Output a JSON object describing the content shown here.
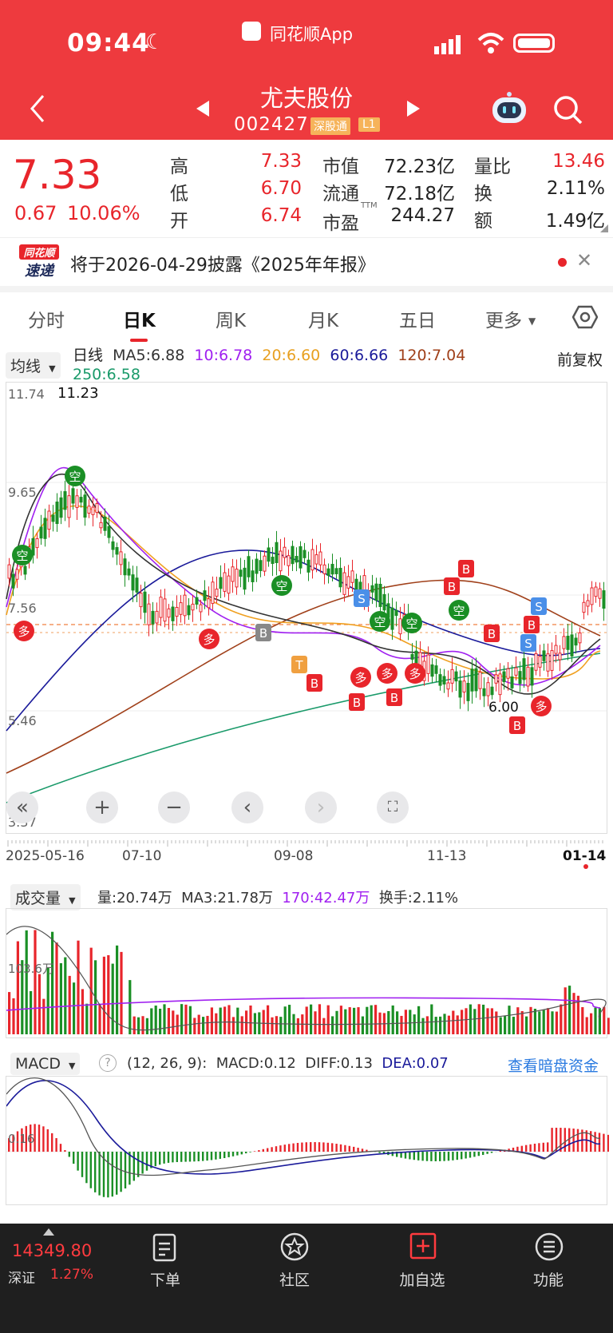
{
  "status_bar": {
    "time": "09:44",
    "app": "同花顺App"
  },
  "header": {
    "title": "尤夫股份",
    "code": "002427",
    "tag_connect": "深股通",
    "tag_level": "L1"
  },
  "quote": {
    "price": "7.33",
    "change": "0.67",
    "change_pct": "10.06%",
    "high_label": "高",
    "high": "7.33",
    "low_label": "低",
    "low": "6.70",
    "open_label": "开",
    "open": "6.74",
    "mcap_label": "市值",
    "mcap": "72.23亿",
    "float_label": "流通",
    "float": "72.18亿",
    "pe_label": "市盈",
    "pe_sup": "TTM",
    "pe": "244.27",
    "vr_label": "量比",
    "vr": "13.46",
    "turn_label": "换",
    "turn": "2.11%",
    "amt_label": "额",
    "amt": "1.49亿"
  },
  "news": {
    "badge_top": "同花顺",
    "badge_bottom": "速递",
    "text": "将于2026-04-29披露《2025年年报》"
  },
  "tabs": [
    "分时",
    "日K",
    "周K",
    "月K",
    "五日",
    "更多"
  ],
  "ma_legend": {
    "selector": "均线",
    "kind": "日线",
    "ma5": "MA5:6.88",
    "ma10": "10:6.78",
    "ma20": "20:6.60",
    "ma60": "60:6.66",
    "ma120": "120:7.04",
    "ma250": "250:6.58",
    "adjust": "前复权"
  },
  "price_axis": {
    "top": "11.74",
    "high_mark": "11.23",
    "p2": "9.65",
    "p3": "7.56",
    "p4": "5.46",
    "bottom": "3.37",
    "low_mark": "6.00"
  },
  "dates": [
    "2025-05-16",
    "07-10",
    "09-08",
    "11-13",
    "01-14"
  ],
  "volume": {
    "selector": "成交量",
    "vol": "量:20.74万",
    "ma3": "MA3:21.78万",
    "ma170": "170:42.47万",
    "turnover": "换手:2.11%",
    "axis": "103.6万"
  },
  "macd": {
    "selector": "MACD",
    "help": "?",
    "params": "(12, 26, 9):",
    "macd": "MACD:0.12",
    "diff": "DIFF:0.13",
    "dea": "DEA:0.07",
    "link": "查看暗盘资金",
    "axis": "0.16"
  },
  "signals": {
    "duo": "多",
    "kong": "空",
    "b": "B",
    "s": "S",
    "t": "T"
  },
  "bottom": {
    "index_value": "14349.80",
    "index_name": "深证",
    "index_pct": "1.27%",
    "items": [
      "下单",
      "社区",
      "加自选",
      "功能"
    ]
  },
  "colors": {
    "up": "#e8252b",
    "down": "#1a8f25",
    "brand": "#ee3a3e",
    "ma5": "#333333",
    "ma10": "#a020f0",
    "ma20": "#f0a020",
    "ma60": "#1a1a9a",
    "ma120": "#a0401a",
    "ma250": "#1a9a6a"
  }
}
